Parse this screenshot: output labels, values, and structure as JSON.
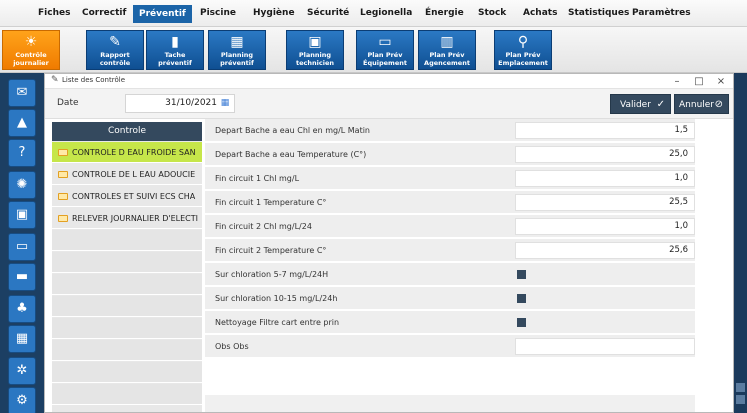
{
  "menu": {
    "items": [
      "Fiches",
      "Correctif",
      "Préventif",
      "Piscine",
      "Hygiène",
      "Sécurité",
      "Legionella",
      "Énergie",
      "Stock",
      "Achats",
      "Statistiques",
      "Paramètres"
    ]
  },
  "ribbon": {
    "buttons": [
      {
        "label": "Contrôle\njournalier",
        "icon": "sun-icon",
        "active": true
      },
      {
        "label": "Rapport\ncontrôle",
        "icon": "edit-icon",
        "active": false
      },
      {
        "label": "Tache\npréventif",
        "icon": "book-icon",
        "active": false
      },
      {
        "label": "Planning\npréventif",
        "icon": "calendar-icon",
        "active": false
      },
      {
        "label": "Planning\ntechnicien",
        "icon": "calendar-user-icon",
        "active": false
      },
      {
        "label": "Plan Prév\nÉquipement",
        "icon": "monitor-icon",
        "active": false
      },
      {
        "label": "Plan Prév\nAgencement",
        "icon": "map-icon",
        "active": false
      },
      {
        "label": "Plan Prév\nEmplacement",
        "icon": "map-pin-icon",
        "active": false
      }
    ]
  },
  "window": {
    "title": "Liste des Contrôle",
    "title_icon": "edit-icon"
  },
  "toolbar": {
    "date_label": "Date",
    "date_value": "31/10/2021",
    "validate_label": "Valider",
    "cancel_label": "Annuler"
  },
  "list": {
    "header": "Controle",
    "items": [
      {
        "label": "CONTROLE D EAU FROIDE SAN",
        "selected": true
      },
      {
        "label": "CONTROLE DE L EAU ADOUCIE",
        "selected": false
      },
      {
        "label": "CONTROLES ET SUIVI ECS CHA",
        "selected": false
      },
      {
        "label": "RELEVER JOURNALIER D'ELECTI",
        "selected": false
      }
    ]
  },
  "form": {
    "rows": [
      {
        "label": "Depart Bache a eau Chl en mg/L Matin",
        "value": "1,5",
        "kind": "number"
      },
      {
        "label": "Depart Bache a eau Temperature (C°)",
        "value": "25,0",
        "kind": "number"
      },
      {
        "label": "Fin circuit 1 Chl mg/L",
        "value": "1,0",
        "kind": "number"
      },
      {
        "label": "Fin circuit 1 Temperature C°",
        "value": "25,5",
        "kind": "number"
      },
      {
        "label": "Fin circuit 2 Chl mg/L/24",
        "value": "1,0",
        "kind": "number"
      },
      {
        "label": "Fin circuit 2 Temperature C°",
        "value": "25,6",
        "kind": "number"
      },
      {
        "label": "Sur chloration 5-7 mg/L/24H",
        "value": "",
        "kind": "checkbox"
      },
      {
        "label": "Sur chloration 10-15 mg/L/24h",
        "value": "",
        "kind": "checkbox"
      },
      {
        "label": "Nettoyage Filtre cart entre prin",
        "value": "",
        "kind": "checkbox"
      },
      {
        "label": "Obs Obs",
        "value": "",
        "kind": "text"
      }
    ]
  },
  "colors": {
    "accent_blue": "#1b64a8",
    "ribbon_active": "#f07b00",
    "dark_button": "#34495e",
    "selected_row": "#c6e64a",
    "sidebar": "#1c3f63"
  }
}
